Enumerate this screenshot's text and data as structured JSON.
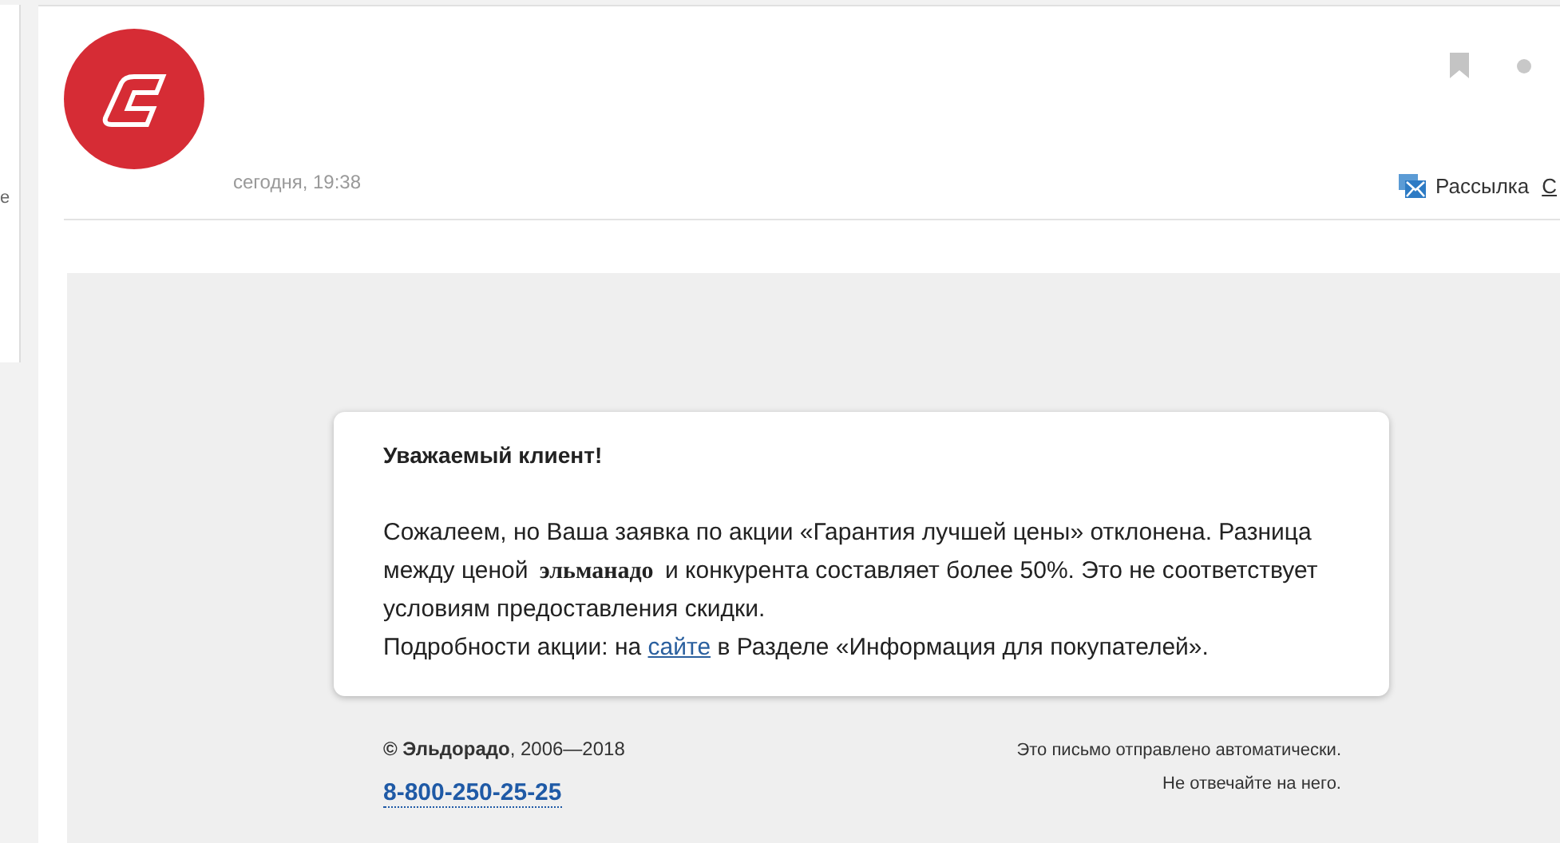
{
  "sidebar": {
    "fragment": "е"
  },
  "header": {
    "date": "сегодня, 19:38",
    "label": "Рассылка",
    "cut_link": "С"
  },
  "card": {
    "greeting": "Уважаемый клиент!",
    "paragraph": "Сожалеем, но Ваша заявка по акции «Гарантия лучшей цены» отклонена. Разница между ценой **эльманадо** и конкурента составляет более 50%. Это не соответствует условиям предоставления скидки.",
    "details": {
      "before": "Подробности акции: на",
      "link": "сайте",
      "after": "в Разделе «Информация для покупателей»."
    }
  },
  "footer": {
    "copyright": "**© Эльдорадо**, 2006—2018",
    "phone": "8-800-250-25-25",
    "notes": [
      "Это письмо отправлено автоматически.",
      "Не отвечайте на него."
    ]
  }
}
